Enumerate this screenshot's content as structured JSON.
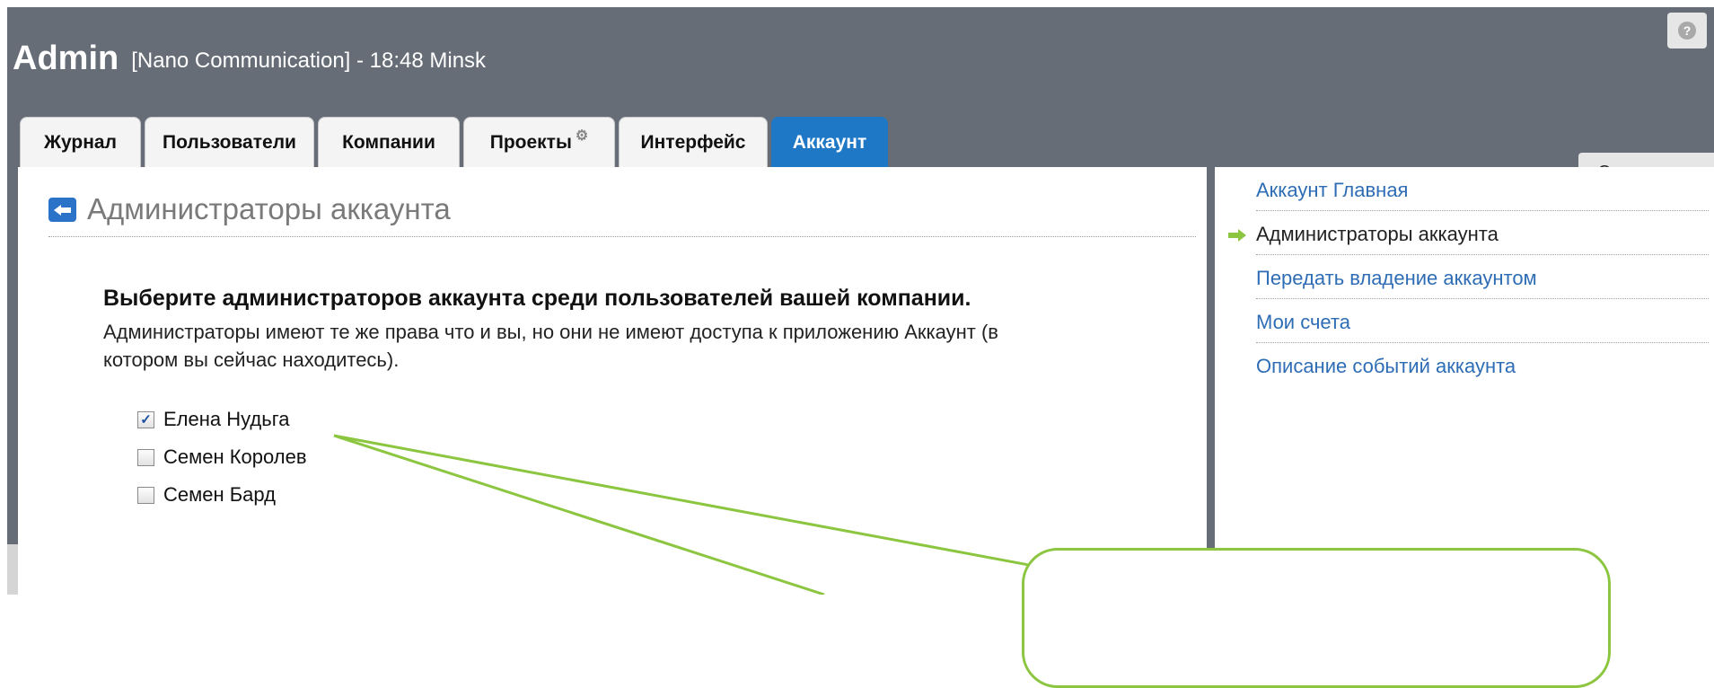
{
  "header": {
    "app_name": "Admin",
    "subtitle": "[Nano Communication] - 18:48 Minsk",
    "help_label": "?"
  },
  "tabs": [
    {
      "label": "Журнал",
      "active": false
    },
    {
      "label": "Пользователи",
      "active": false
    },
    {
      "label": "Компании",
      "active": false
    },
    {
      "label": "Проекты",
      "active": false,
      "icon": "gear-icon"
    },
    {
      "label": "Интерфейс",
      "active": false
    },
    {
      "label": "Аккаунт",
      "active": true
    }
  ],
  "staff_tab": "Сотрудники",
  "main": {
    "title": "Администраторы аккаунта",
    "lead": "Выберите администраторов аккаунта среди пользователей вашей компании.",
    "description": "Администраторы имеют те же права что и вы, но они не имеют доступа к приложению Аккаунт (в котором вы сейчас находитесь).",
    "users": [
      {
        "name": "Елена Нудьга",
        "checked": true
      },
      {
        "name": "Семен Королев",
        "checked": false
      },
      {
        "name": "Семен Бард",
        "checked": false
      }
    ]
  },
  "sidebar": {
    "items": [
      {
        "label": "Аккаунт Главная",
        "current": false
      },
      {
        "label": "Администраторы аккаунта",
        "current": true
      },
      {
        "label": "Передать владение аккаунтом",
        "current": false
      },
      {
        "label": "Мои счета",
        "current": false
      },
      {
        "label": "Описание событий аккаунта",
        "current": false
      }
    ]
  },
  "colors": {
    "header_bg": "#666d76",
    "active_tab": "#1f78c6",
    "link": "#2e6db5",
    "callout": "#8cc641"
  }
}
